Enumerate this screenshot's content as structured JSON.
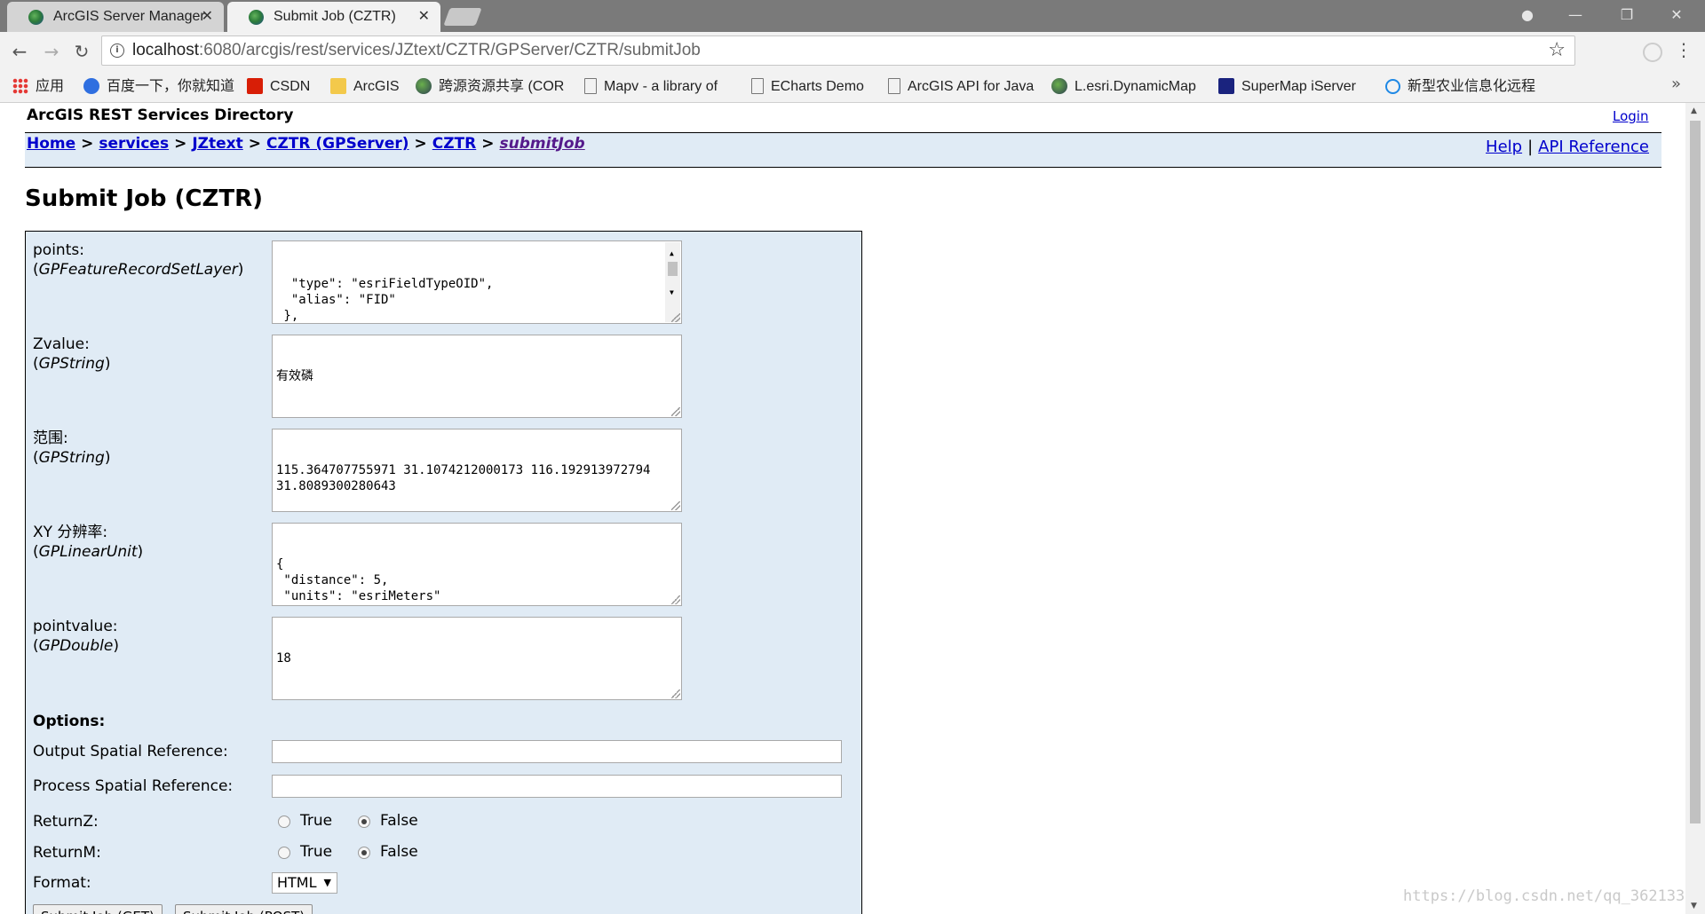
{
  "tabs": [
    {
      "title": "ArcGIS Server Manager",
      "active": false
    },
    {
      "title": "Submit Job (CZTR)",
      "active": true
    }
  ],
  "address_bar": {
    "host": "localhost",
    "rest": ":6080/arcgis/rest/services/JZtext/CZTR/GPServer/CZTR/submitJob"
  },
  "bookmarks": [
    {
      "label": "应用",
      "icon": "apps-grid-icon"
    },
    {
      "label": "百度一下，你就知道",
      "icon": "baidu-paw-icon"
    },
    {
      "label": "CSDN",
      "icon": "csdn-icon"
    },
    {
      "label": "ArcGIS",
      "icon": "folder-icon"
    },
    {
      "label": "跨源资源共享 (COR",
      "icon": "globe-icon"
    },
    {
      "label": "Mapv - a library of",
      "icon": "page-icon"
    },
    {
      "label": "ECharts Demo",
      "icon": "page-icon"
    },
    {
      "label": "ArcGIS API for Java",
      "icon": "page-icon"
    },
    {
      "label": "L.esri.DynamicMap",
      "icon": "globe-icon"
    },
    {
      "label": "SuperMap iServer",
      "icon": "supermap-icon"
    },
    {
      "label": "新型农业信息化远程",
      "icon": "ie-icon"
    }
  ],
  "header": {
    "directory_title": "ArcGIS REST Services Directory",
    "login": "Login"
  },
  "breadcrumbs": [
    "Home",
    "services",
    "JZtext",
    "CZTR (GPServer)",
    "CZTR",
    "submitJob"
  ],
  "breadcrumb_separator": ">",
  "help_links": {
    "help": "Help",
    "separator": "|",
    "api_reference": "API Reference"
  },
  "page_title": "Submit Job (CZTR)",
  "parameters": [
    {
      "name": "points:",
      "type": "GPFeatureRecordSetLayer",
      "value": "  \"type\": \"esriFieldTypeOID\",\n  \"alias\": \"FID\"\n },\n {\n  \"name\": \"村名\","
    },
    {
      "name": "Zvalue:",
      "type": "GPString",
      "value": "有效磷"
    },
    {
      "name": "范围:",
      "type": "GPString",
      "value": "115.364707755971 31.1074212000173 116.192913972794\n31.8089300280643"
    },
    {
      "name": "XY 分辨率:",
      "type": "GPLinearUnit",
      "value": "{\n \"distance\": 5,\n \"units\": \"esriMeters\"\n}"
    },
    {
      "name": "pointvalue:",
      "type": "GPDouble",
      "value": "18"
    }
  ],
  "options": {
    "title": "Options:",
    "output_sr_label": "Output Spatial Reference:",
    "output_sr_value": "",
    "process_sr_label": "Process Spatial Reference:",
    "process_sr_value": "",
    "returnz_label": "ReturnZ:",
    "returnm_label": "ReturnM:",
    "true_label": "True",
    "false_label": "False",
    "returnz_selected": "False",
    "returnm_selected": "False",
    "format_label": "Format:",
    "format_value": "HTML"
  },
  "buttons": {
    "get": "Submit Job (GET)",
    "post": "Submit Job (POST)"
  },
  "watermark": "https://blog.csdn.net/qq_36213352"
}
